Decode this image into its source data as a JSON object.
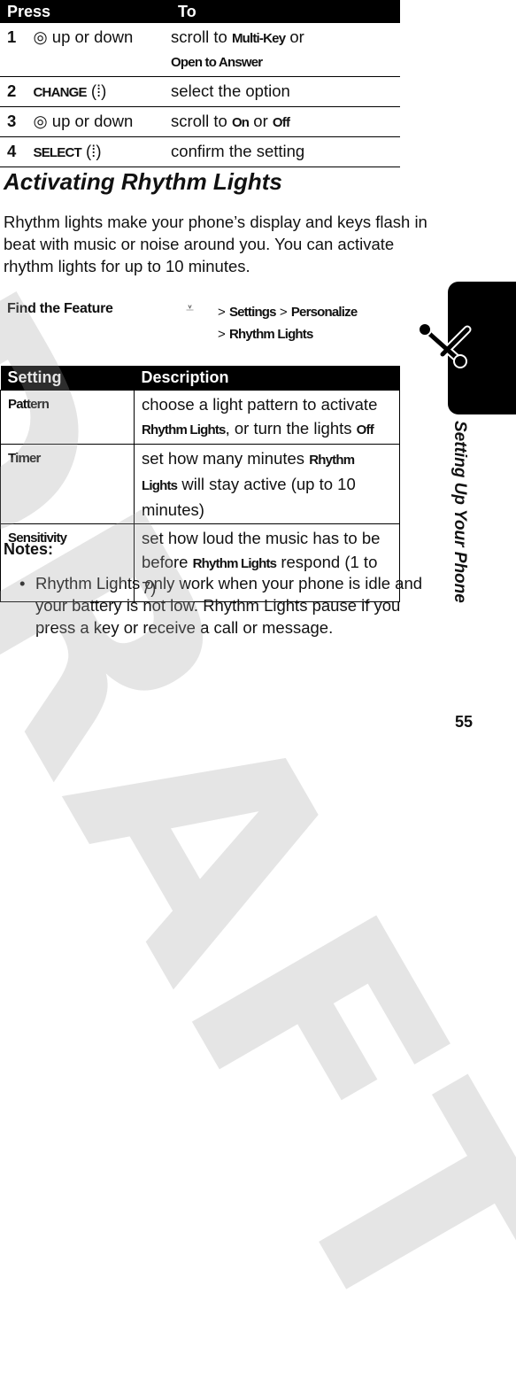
{
  "watermark": "DRAFT",
  "steps_table": {
    "headers": [
      "Press",
      "To"
    ],
    "rows": [
      {
        "num": "1",
        "icon": "nav-key-icon",
        "press": "up or down",
        "to_pre": "scroll to ",
        "to_key1": "Multi-Key",
        "to_mid": " or ",
        "to_key2": "Open to Answer"
      },
      {
        "num": "2",
        "press_key": "CHANGE",
        "icon": "soft-key-icon",
        "to": "select the option"
      },
      {
        "num": "3",
        "icon": "nav-key-icon",
        "press": "up or down",
        "to_pre": "scroll to ",
        "to_key1": "On",
        "to_mid": " or ",
        "to_key2": "Off"
      },
      {
        "num": "4",
        "press_key": "SELECT",
        "icon": "soft-key-icon",
        "to": "confirm the setting"
      }
    ]
  },
  "heading": "Activating Rhythm Lights",
  "intro": "Rhythm lights make your phone’s display and keys flash in beat with music or noise around you. You can activate rhythm lights for up to 10 minutes.",
  "find_feature": {
    "label": "Find the Feature",
    "icon": "menu-key-icon",
    "path": [
      "Settings",
      "Personalize",
      "Rhythm Lights"
    ],
    "sep": ">"
  },
  "settings_table": {
    "headers": [
      "Setting",
      "Description"
    ],
    "rows": [
      {
        "setting": "Pattern",
        "d1": "choose a light pattern to activate ",
        "k1": "Rhythm Lights",
        "d2": ", or turn the lights ",
        "k2": "Off",
        "d3": ""
      },
      {
        "setting": "Timer",
        "d1": "set how many minutes ",
        "k1": "Rhythm Lights",
        "d2": " will stay active (up to 10 minutes)",
        "k2": "",
        "d3": ""
      },
      {
        "setting": "Sensitivity",
        "d1": "set how loud the music has to be before ",
        "k1": "Rhythm Lights",
        "d2": " respond (1 to 7)",
        "k2": "",
        "d3": ""
      }
    ]
  },
  "notes": {
    "title": "Notes:",
    "items": [
      "Rhythm Lights only work when your phone is idle and your battery is not low. Rhythm Lights pause if you press a key or receive a call or message."
    ]
  },
  "side_tab": {
    "label": "Setting Up Your Phone",
    "icon": "tools-icon"
  },
  "page_number": "55"
}
